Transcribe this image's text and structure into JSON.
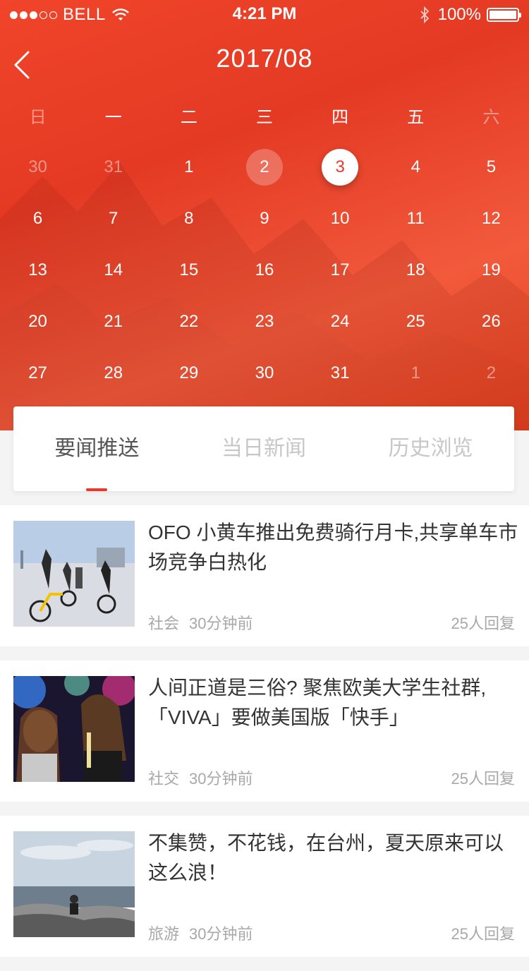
{
  "status_bar": {
    "carrier": "BELL",
    "time": "4:21 PM",
    "battery": "100%"
  },
  "calendar": {
    "title": "2017/08",
    "weekdays": [
      "日",
      "一",
      "二",
      "三",
      "四",
      "五",
      "六"
    ],
    "weeks": [
      [
        "30",
        "31",
        "1",
        "2",
        "3",
        "4",
        "5"
      ],
      [
        "6",
        "7",
        "8",
        "9",
        "10",
        "11",
        "12"
      ],
      [
        "13",
        "14",
        "15",
        "16",
        "17",
        "18",
        "19"
      ],
      [
        "20",
        "21",
        "22",
        "23",
        "24",
        "25",
        "26"
      ],
      [
        "27",
        "28",
        "29",
        "30",
        "31",
        "1",
        "2"
      ]
    ],
    "today": "2",
    "selected": "3"
  },
  "tabs": [
    {
      "label": "要闻推送",
      "active": true
    },
    {
      "label": "当日新闻",
      "active": false
    },
    {
      "label": "历史浏览",
      "active": false
    }
  ],
  "news": [
    {
      "title": "OFO 小黄车推出免费骑行月卡,共享单车市场竞争白热化",
      "category": "社会",
      "time": "30分钟前",
      "replies": "25人回复"
    },
    {
      "title": "人间正道是三俗? 聚焦欧美大学生社群,「VIVA」要做美国版「快手」",
      "category": "社交",
      "time": "30分钟前",
      "replies": "25人回复"
    },
    {
      "title": "不集赞，不花钱，在台州，夏天原来可以这么浪！",
      "category": "旅游",
      "time": "30分钟前",
      "replies": "25人回复"
    }
  ],
  "colors": {
    "accent": "#e8392a",
    "header": "#ef4428"
  },
  "icons": {
    "back": "chevron-left-icon",
    "wifi": "wifi-icon",
    "bluetooth": "bluetooth-icon",
    "battery": "battery-icon"
  }
}
